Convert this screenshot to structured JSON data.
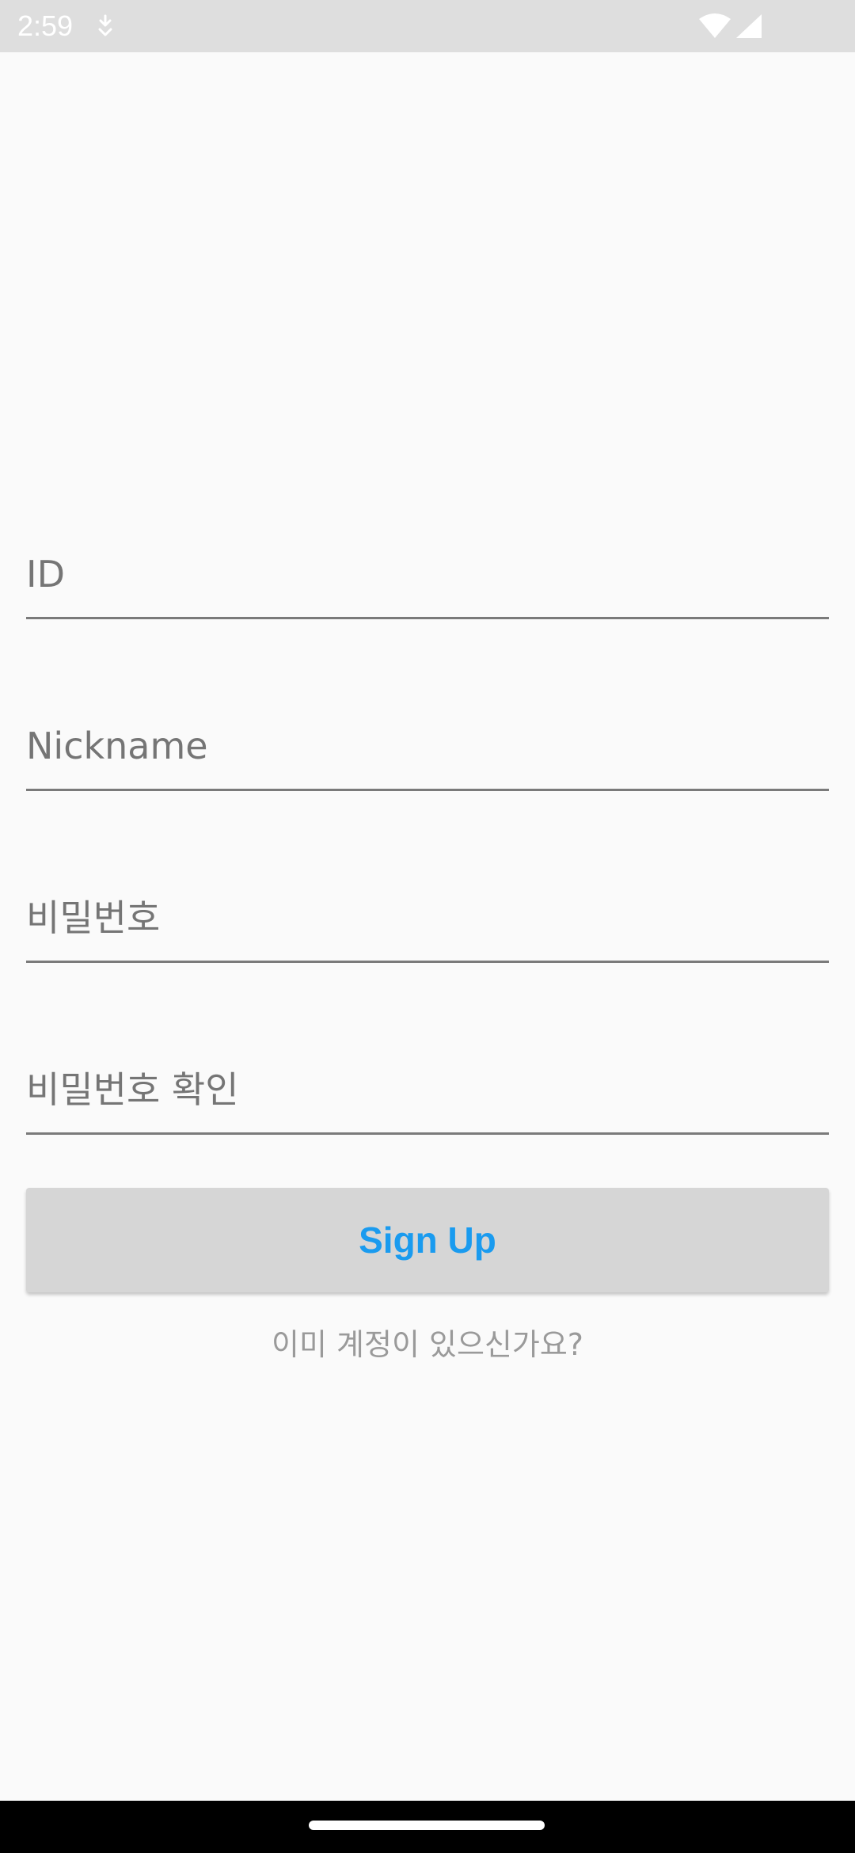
{
  "status_bar": {
    "time": "2:59",
    "icons": [
      "download-notification-icon",
      "wifi-icon",
      "cell-signal-icon"
    ]
  },
  "form": {
    "id_placeholder": "ID",
    "nickname_placeholder": "Nickname",
    "password_placeholder": "비밀번호",
    "password_confirm_placeholder": "비밀번호 확인",
    "signup_label": "Sign Up",
    "login_link": "이미 계정이 있으신가요?"
  },
  "colors": {
    "background": "#fafafa",
    "button_bg": "#d6d6d6",
    "button_text": "#1a9bef",
    "hint_text": "#757575",
    "link_text": "#9a9a9a"
  }
}
